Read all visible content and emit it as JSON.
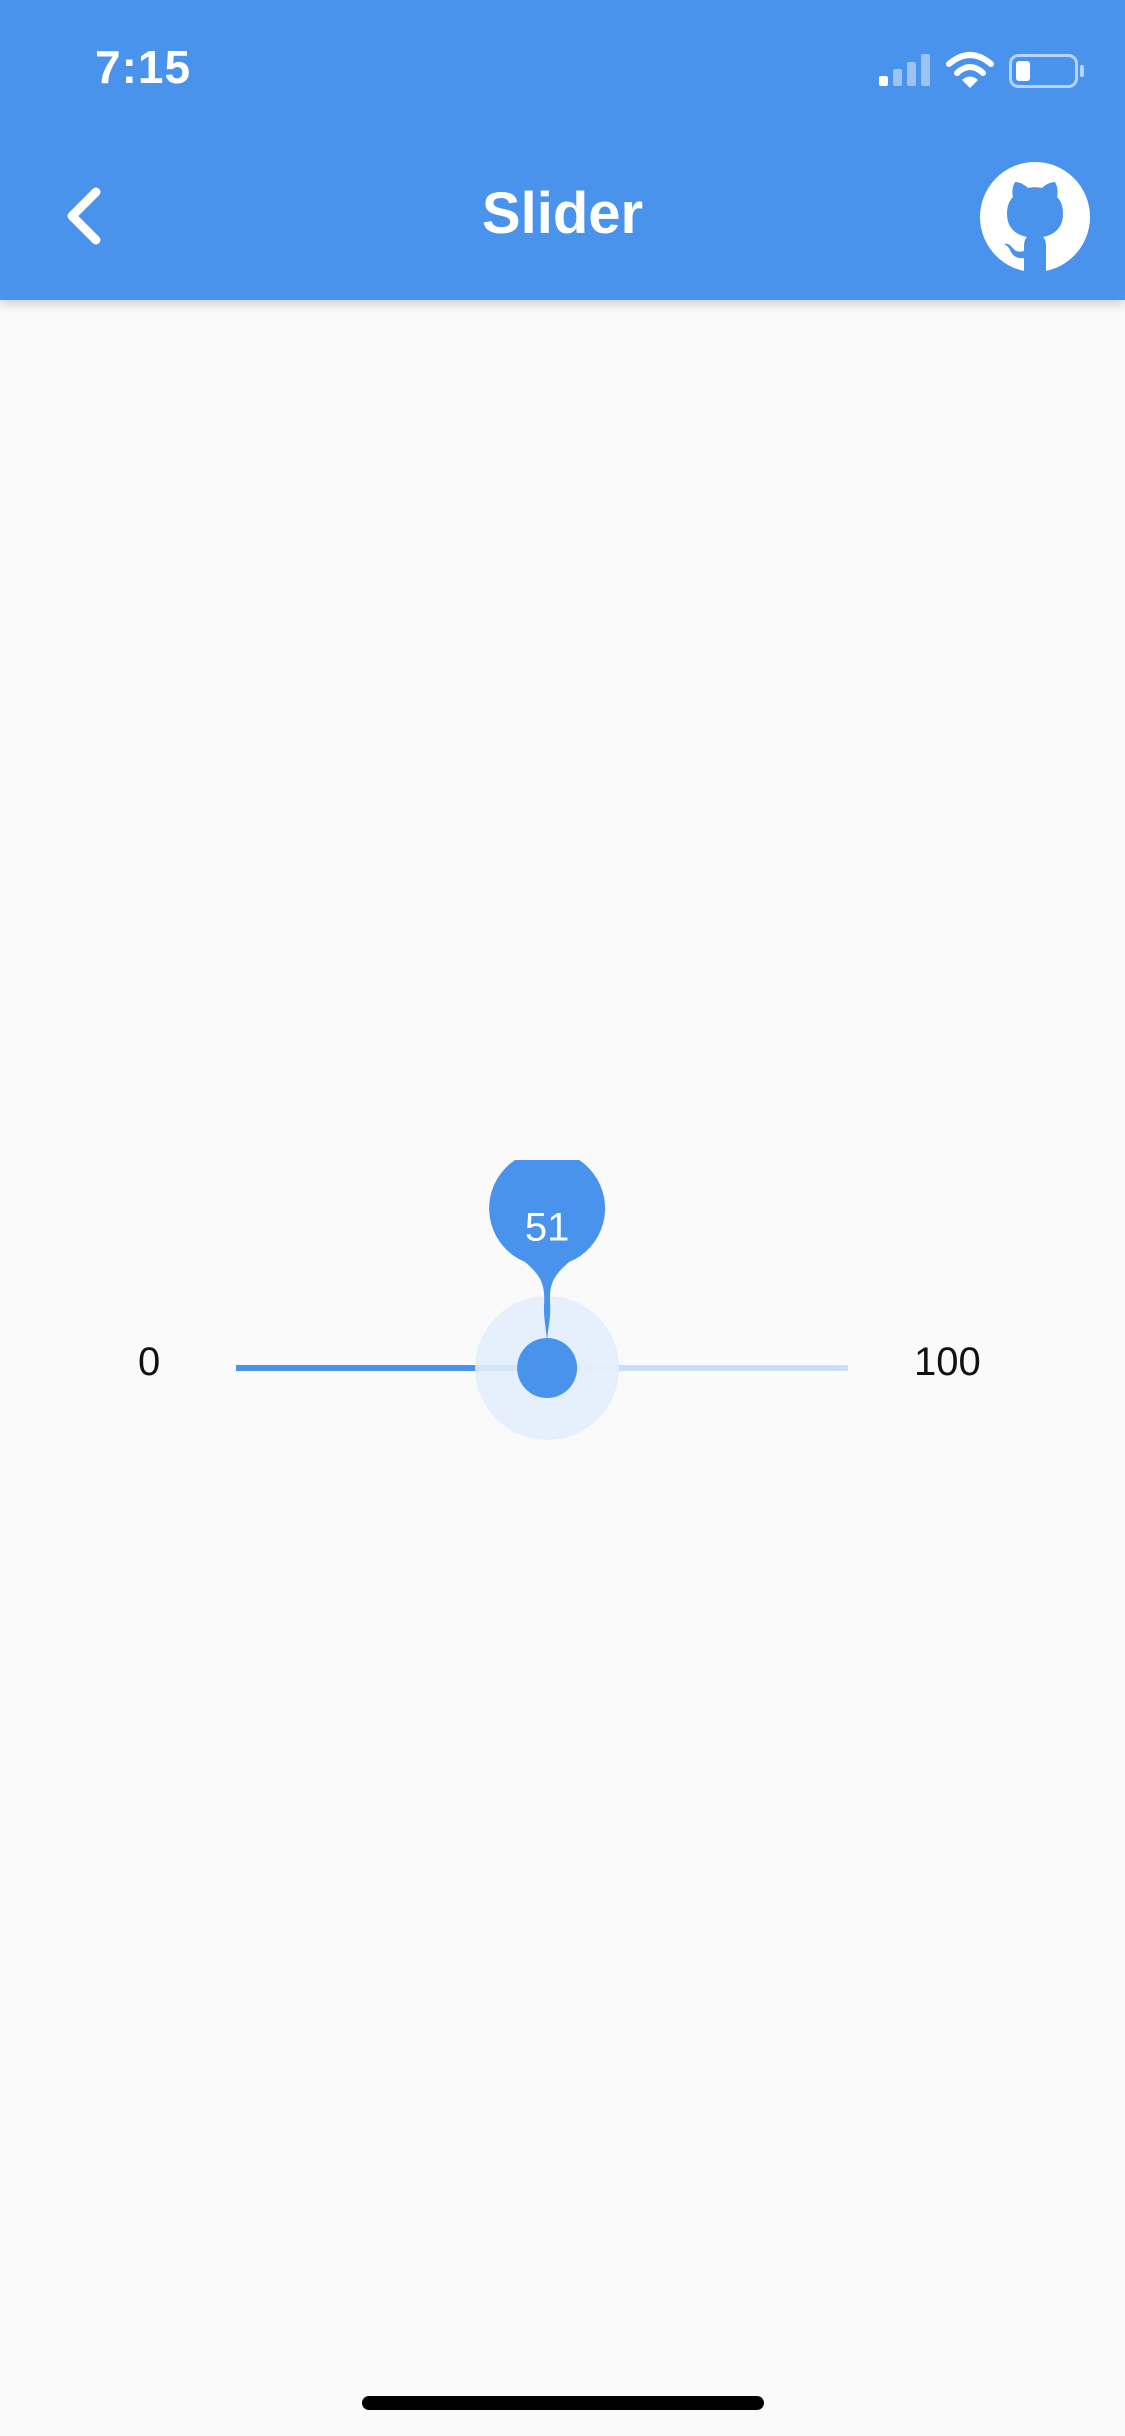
{
  "status_bar": {
    "time": "7:15",
    "icons": [
      "cellular-signal-icon",
      "wifi-icon",
      "battery-icon"
    ]
  },
  "app_bar": {
    "title": "Slider",
    "back_icon": "chevron-left-icon",
    "action_icon": "github-icon"
  },
  "slider": {
    "min_label": "0",
    "max_label": "100",
    "min": 0,
    "max": 100,
    "value": 51,
    "value_label": "51"
  },
  "colors": {
    "primary": "#4a93ec",
    "inactive_track": "#c9def8",
    "overlay": "#e3eefc",
    "background": "#fafafa"
  }
}
